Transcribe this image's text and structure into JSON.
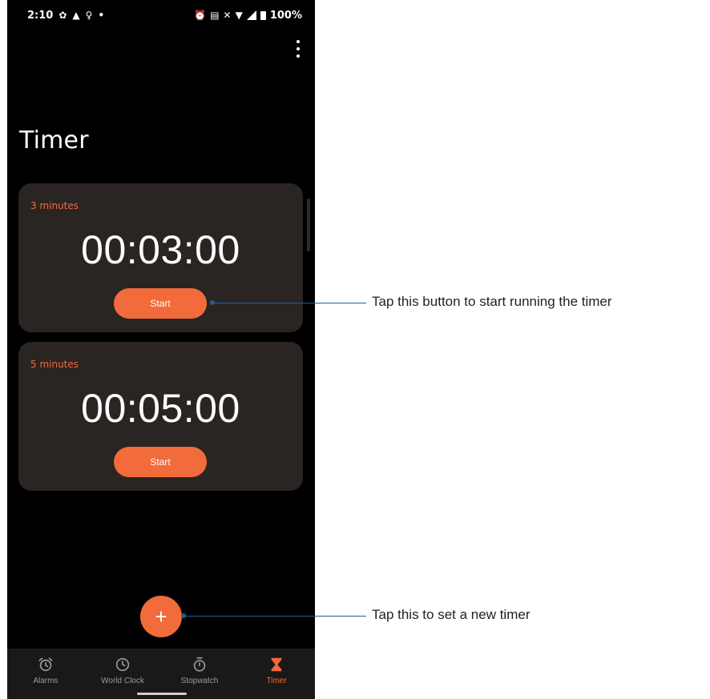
{
  "status_bar": {
    "time": "2:10",
    "battery": "100%",
    "left_icons": [
      "gear-icon",
      "warning-icon",
      "bulb-icon",
      "dot-icon"
    ],
    "right_icons": [
      "alarm-icon",
      "message-icon",
      "mute-icon",
      "wifi-icon",
      "signal-icon",
      "battery-icon"
    ]
  },
  "page": {
    "title": "Timer"
  },
  "timers": [
    {
      "label": "3 minutes",
      "time": "00:03:00",
      "button_label": "Start"
    },
    {
      "label": "5 minutes",
      "time": "00:05:00",
      "button_label": "Start"
    }
  ],
  "fab": {
    "label": "+"
  },
  "nav": {
    "items": [
      {
        "label": "Alarms",
        "icon": "alarm-clock-icon",
        "active": false
      },
      {
        "label": "World Clock",
        "icon": "clock-icon",
        "active": false
      },
      {
        "label": "Stopwatch",
        "icon": "stopwatch-icon",
        "active": false
      },
      {
        "label": "Timer",
        "icon": "hourglass-icon",
        "active": true
      }
    ]
  },
  "callouts": {
    "start": "Tap this button to start running the timer",
    "new_timer": "Tap this to set a new timer"
  },
  "colors": {
    "accent": "#f26b3a",
    "card": "#2a2422",
    "background": "#000000",
    "callout_line": "#1f5e9b"
  }
}
